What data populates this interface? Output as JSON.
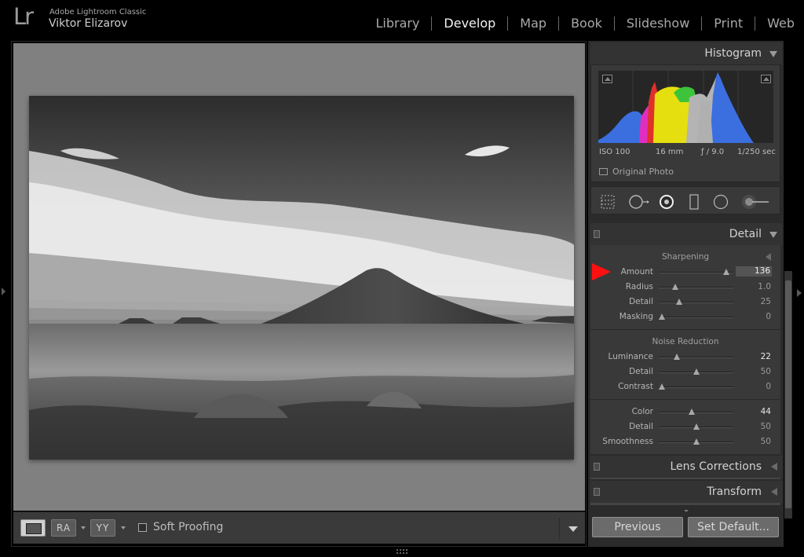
{
  "app": {
    "logo": "Lr",
    "product_name": "Adobe Lightroom Classic",
    "user_name": "Viktor Elizarov"
  },
  "modules": [
    "Library",
    "Develop",
    "Map",
    "Book",
    "Slideshow",
    "Print",
    "Web"
  ],
  "active_module": "Develop",
  "toolbar": {
    "before_after_label": "RA",
    "yy_label": "YY",
    "soft_proofing_label": "Soft Proofing",
    "soft_proofing_checked": false
  },
  "histogram": {
    "title": "Histogram",
    "iso": "ISO 100",
    "focal_length": "16 mm",
    "aperture": "ƒ / 9.0",
    "shutter": "1/250 sec",
    "original_photo_label": "Original Photo",
    "colors": {
      "blue": "#3b6fe0",
      "yellow": "#e6df10",
      "green": "#3ec43b",
      "magenta": "#e02fc0",
      "red": "#e0302a",
      "gray": "#b4b4b4"
    }
  },
  "tools": [
    "crop-overlay-icon",
    "spot-removal-icon",
    "red-eye-icon",
    "graduated-filter-icon",
    "radial-filter-icon",
    "adjustment-brush-icon"
  ],
  "detail": {
    "title": "Detail",
    "sharpening": {
      "label": "Sharpening",
      "sliders": [
        {
          "label": "Amount",
          "value": "136",
          "fraction": 0.9
        },
        {
          "label": "Radius",
          "value": "1.0",
          "fraction": 0.22
        },
        {
          "label": "Detail",
          "value": "25",
          "fraction": 0.27
        },
        {
          "label": "Masking",
          "value": "0",
          "fraction": 0.04
        }
      ]
    },
    "noise_reduction": {
      "label": "Noise Reduction",
      "luminance_sliders": [
        {
          "label": "Luminance",
          "value": "22",
          "fraction": 0.24
        },
        {
          "label": "Detail",
          "value": "50",
          "fraction": 0.5
        },
        {
          "label": "Contrast",
          "value": "0",
          "fraction": 0.04
        }
      ],
      "color_sliders": [
        {
          "label": "Color",
          "value": "44",
          "fraction": 0.44
        },
        {
          "label": "Detail",
          "value": "50",
          "fraction": 0.5
        },
        {
          "label": "Smoothness",
          "value": "50",
          "fraction": 0.5
        }
      ]
    }
  },
  "panels_collapsed": [
    "Lens Corrections",
    "Transform"
  ],
  "buttons": {
    "previous": "Previous",
    "set_default": "Set Default..."
  }
}
